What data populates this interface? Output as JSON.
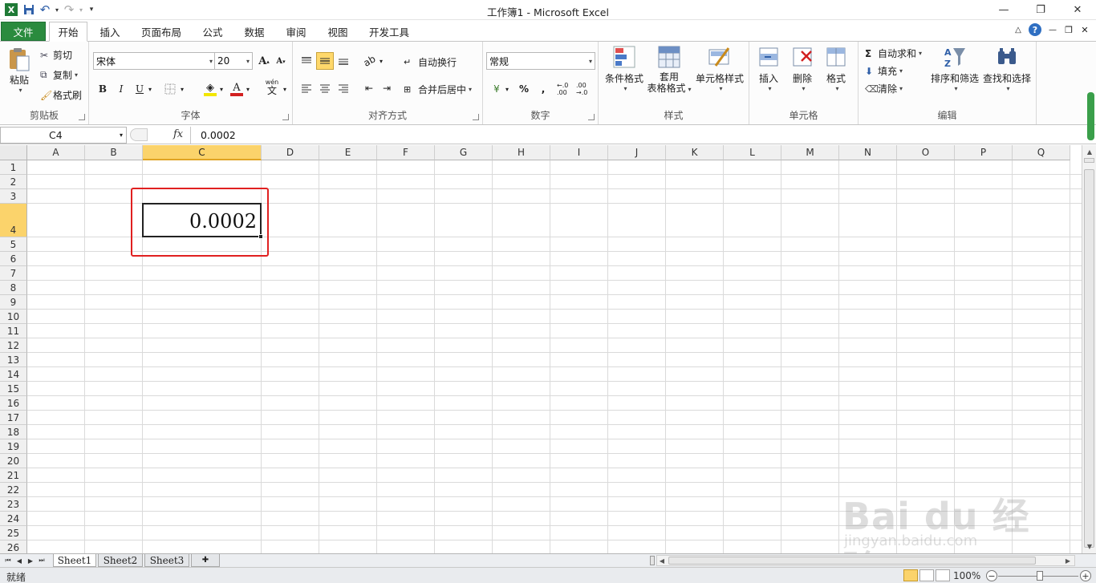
{
  "window": {
    "title": "工作簿1 - Microsoft Excel",
    "minimize": "—",
    "restore": "❐",
    "close": "✕"
  },
  "quick_access": {
    "excel_icon": "X",
    "save": "💾",
    "undo": "↶",
    "redo": "↷",
    "customize": "▾"
  },
  "tabs": {
    "file": "文件",
    "items": [
      "开始",
      "插入",
      "页面布局",
      "公式",
      "数据",
      "审阅",
      "视图",
      "开发工具"
    ]
  },
  "ribbon": {
    "clipboard": {
      "label": "剪贴板",
      "paste": "粘贴",
      "cut": "剪切",
      "copy": "复制",
      "format_painter": "格式刷"
    },
    "font": {
      "label": "字体",
      "font_name": "宋体",
      "font_size": "20",
      "grow": "A",
      "shrink": "A",
      "bold": "B",
      "italic": "I",
      "underline": "U",
      "font_color_glyph": "A",
      "phonetic": "wén",
      "phonetic_char": "文",
      "fill_color": "#f2e600",
      "font_color": "#d22020"
    },
    "alignment": {
      "label": "对齐方式",
      "wrap_text": "自动换行",
      "merge_center": "合并后居中"
    },
    "number": {
      "label": "数字",
      "format": "常规",
      "percent": "%",
      "comma": ",",
      "inc_dec": "←.0 .00",
      "dec_dec": ".00 →.0"
    },
    "styles": {
      "label": "样式",
      "conditional": "条件格式",
      "table_line1": "套用",
      "table_line2": "表格格式",
      "cell_styles": "单元格样式"
    },
    "cells": {
      "label": "单元格",
      "insert": "插入",
      "delete": "删除",
      "format": "格式"
    },
    "editing": {
      "label": "编辑",
      "autosum": "自动求和",
      "fill": "填充",
      "clear": "清除",
      "sort_filter": "排序和筛选",
      "find_select": "查找和选择",
      "sigma": "Σ"
    }
  },
  "formula_bar": {
    "name_box": "C4",
    "fx": "fx",
    "value": "0.0002"
  },
  "grid": {
    "columns": [
      "A",
      "B",
      "C",
      "D",
      "E",
      "F",
      "G",
      "H",
      "I",
      "J",
      "K",
      "L",
      "M",
      "N",
      "O",
      "P",
      "Q"
    ],
    "rows": [
      "1",
      "2",
      "3",
      "4",
      "5",
      "6",
      "7",
      "8",
      "9",
      "10",
      "11",
      "12",
      "13",
      "14",
      "15",
      "16",
      "17",
      "18",
      "19",
      "20",
      "21",
      "22",
      "23",
      "24",
      "25",
      "26"
    ],
    "selected_column": "C",
    "selected_row": "4",
    "active_cell_value": "0.0002"
  },
  "sheets": {
    "tabs": [
      "Sheet1",
      "Sheet2",
      "Sheet3"
    ],
    "active": "Sheet1"
  },
  "status": {
    "ready": "就绪",
    "zoom": "100%",
    "zoom_out": "−",
    "zoom_in": "+"
  },
  "watermark": {
    "brand": "Bai du 经验",
    "url": "jingyan.baidu.com"
  },
  "colors": {
    "file_tab": "#2a8b3e",
    "selection_header": "#fbd36b",
    "highlight_box": "#e02020"
  }
}
